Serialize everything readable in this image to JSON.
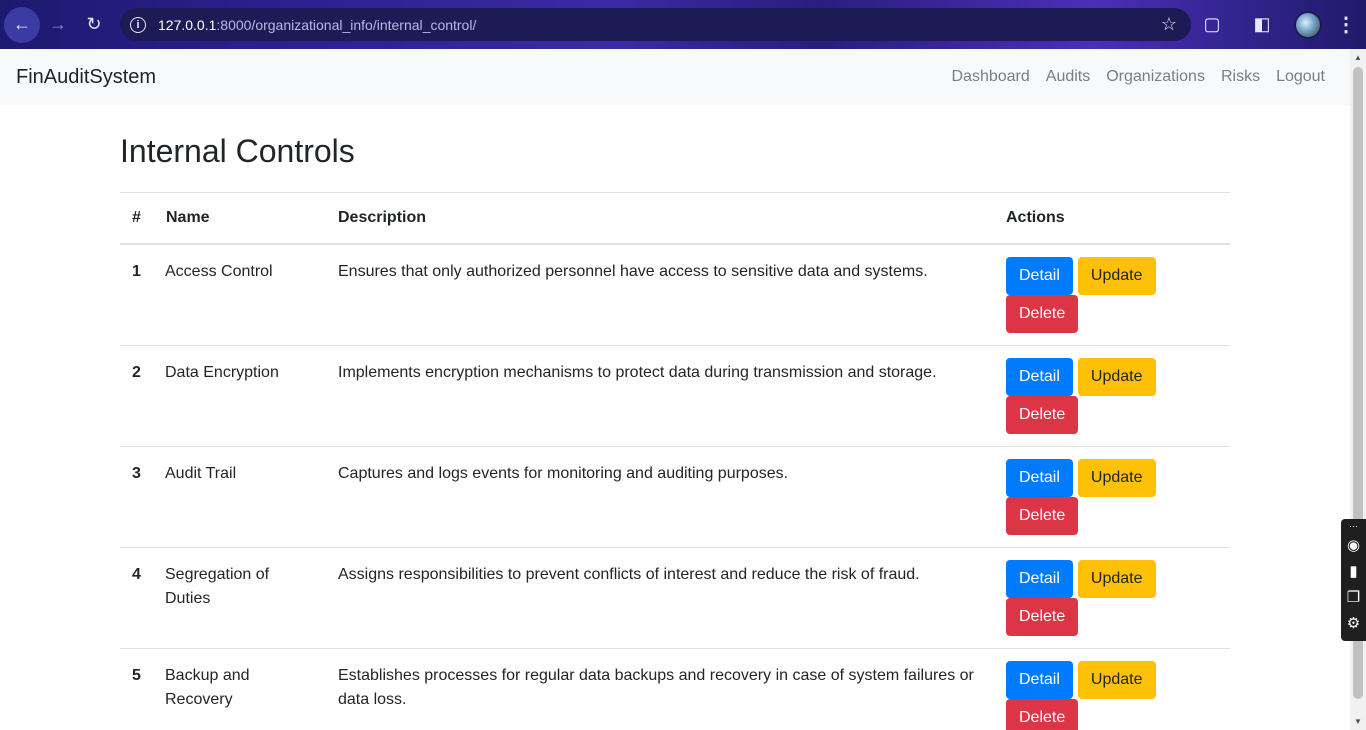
{
  "browser": {
    "url_host": "127.0.0.1",
    "url_path": ":8000/organizational_info/internal_control/"
  },
  "navbar": {
    "brand": "FinAuditSystem",
    "links": [
      "Dashboard",
      "Audits",
      "Organizations",
      "Risks",
      "Logout"
    ]
  },
  "page": {
    "title": "Internal Controls",
    "columns": [
      "#",
      "Name",
      "Description",
      "Actions"
    ],
    "buttons": {
      "detail": "Detail",
      "update": "Update",
      "delete": "Delete"
    },
    "rows": [
      {
        "num": "1",
        "name": "Access Control",
        "description": "Ensures that only authorized personnel have access to sensitive data and systems."
      },
      {
        "num": "2",
        "name": "Data Encryption",
        "description": "Implements encryption mechanisms to protect data during transmission and storage."
      },
      {
        "num": "3",
        "name": "Audit Trail",
        "description": "Captures and logs events for monitoring and auditing purposes."
      },
      {
        "num": "4",
        "name": "Segregation of Duties",
        "description": "Assigns responsibilities to prevent conflicts of interest and reduce the risk of fraud."
      },
      {
        "num": "5",
        "name": "Backup and Recovery",
        "description": "Establishes processes for regular data backups and recovery in case of system failures or data loss."
      }
    ]
  },
  "colors": {
    "primary": "#007bff",
    "warning": "#ffc107",
    "danger": "#dc3545",
    "navbar_bg": "#f8f9fa"
  }
}
